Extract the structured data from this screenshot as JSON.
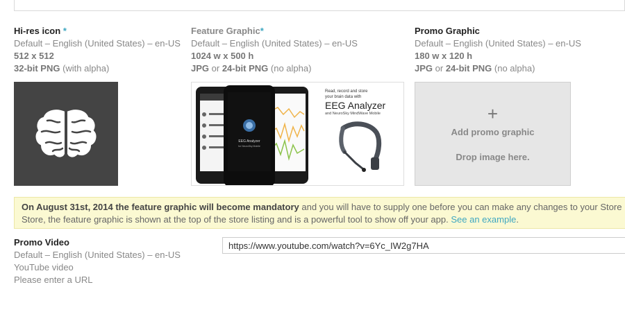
{
  "hires_icon": {
    "title": "Hi-res icon",
    "required_mark": "*",
    "locale": "Default – English (United States) – en-US",
    "size": "512 x 512",
    "format_bold": "32-bit PNG",
    "format_rest": " (with alpha)"
  },
  "feature_graphic": {
    "title": "Feature Graphic",
    "required_mark": "*",
    "locale": "Default – English (United States) – en-US",
    "size": "1024 w x 500 h",
    "format_bold1": "JPG",
    "format_or": " or ",
    "format_bold2": "24-bit PNG",
    "format_rest": " (no alpha)",
    "image": {
      "tagline_line1": "Read, record and store",
      "tagline_line2": "your brain data with",
      "app_name": "EEG Analyzer",
      "subline": "and NeuroSky MindWave Mobile",
      "phone_center_label": "EEG Analyzer",
      "phone_center_sub": "for NeuroSky Mobile"
    }
  },
  "promo_graphic": {
    "title": "Promo Graphic",
    "locale": "Default – English (United States) – en-US",
    "size": "180 w x 120 h",
    "format_bold1": "JPG",
    "format_or": " or ",
    "format_bold2": "24-bit PNG",
    "format_rest": " (no alpha)",
    "plus": "+",
    "add_label": "Add promo graphic",
    "drop_label": "Drop image here."
  },
  "notice": {
    "bold": "On August 31st, 2014 the feature graphic will become mandatory",
    "text1": " and you will have to supply one before you can make any changes to your Store",
    "text2": "Store, the feature graphic is shown at the top of the store listing and is a powerful tool to show off your app. ",
    "link": "See an example",
    "end": "."
  },
  "promo_video": {
    "title": "Promo Video",
    "locale": "Default – English (United States) – en-US",
    "type": "YouTube video",
    "hint": "Please enter a URL",
    "url_value": "https://www.youtube.com/watch?v=6Yc_IW2g7HA"
  },
  "colors": {
    "accent": "#3fa7c1",
    "notice_bg": "#fbf9d2"
  }
}
